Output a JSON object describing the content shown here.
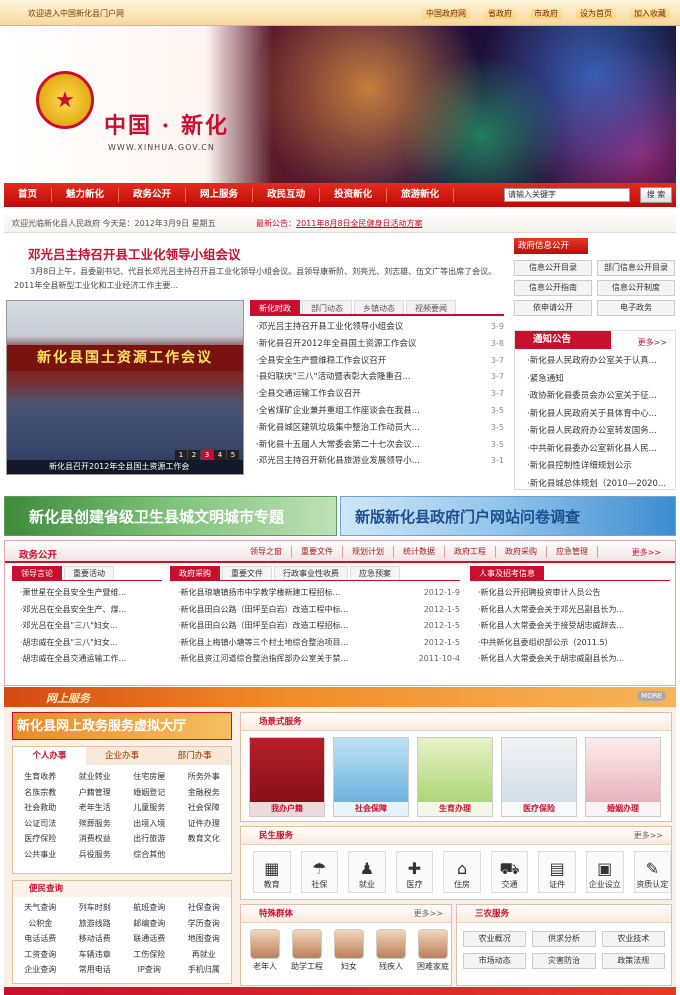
{
  "topbar": {
    "welcome": "欢迎进入中国新化县门户网",
    "links": [
      "中国政府网",
      "省政府",
      "市政府",
      "设为首页",
      "加入收藏"
    ]
  },
  "banner": {
    "title": "中国 · 新化",
    "url": "WWW.XINHUA.GOV.CN"
  },
  "nav": {
    "items": [
      "首页",
      "魅力新化",
      "政务公开",
      "网上服务",
      "政民互动",
      "投资新化",
      "旅游新化"
    ],
    "search_placeholder": "请输入关键字",
    "search_button": "搜 索"
  },
  "infobar": {
    "text": "欢迎光临新化县人民政府 今天是：2012年3月9日 星期五",
    "notice_label": "最新公告：",
    "notice_text": "2011年8月8日全民健身日活动方案"
  },
  "headline": {
    "title": "邓光吕主持召开县工业化领导小组会议",
    "summary": "3月8日上午，县委副书记、代县长邓光吕主持召开县工业化领导小组会议。县领导康新阶、刘亮光、刘志雄、伍文广等出席了会议。 2011年全县新型工业化和工业经济工作主要..."
  },
  "slide": {
    "band": "新化县国土资源工作会议",
    "caption": "新化县召开2012年全县国土资源工作会",
    "dots": [
      "1",
      "2",
      "3",
      "4",
      "5"
    ]
  },
  "news": {
    "tabs": [
      "新化时政",
      "部门动态",
      "乡镇动态",
      "视频要闻"
    ],
    "items": [
      {
        "title": "·邓光吕主持召开县工业化领导小组会议",
        "date": "3-9"
      },
      {
        "title": "·新化县召开2012年全县国土资源工作会议",
        "date": "3-8"
      },
      {
        "title": "·全县安全生产暨维稳工作会议召开",
        "date": "3-7"
      },
      {
        "title": "·县妇联庆\"三八\"活动暨表彰大会隆重召...",
        "date": "3-7"
      },
      {
        "title": "·全县交通运输工作会议召开",
        "date": "3-7"
      },
      {
        "title": "·全省煤矿企业兼并重组工作座谈会在我县...",
        "date": "3-5"
      },
      {
        "title": "·新化县城区建筑垃圾集中整治工作动员大...",
        "date": "3-5"
      },
      {
        "title": "·新化县十五届人大常委会第二十七次会议...",
        "date": "3-5"
      },
      {
        "title": "·邓光吕主持召开新化县旅游业发展领导小...",
        "date": "3-1"
      }
    ]
  },
  "govinfo": {
    "title": "政府信息公开",
    "buttons": [
      "信息公开目录",
      "部门信息公开目录",
      "信息公开指南",
      "信息公开制度",
      "依申请公开",
      "电子政务"
    ]
  },
  "notice": {
    "title": "通知公告",
    "more": "更多>>",
    "items": [
      "·新化县人民政府办公室关于认真...",
      "·紧急通知",
      "·政协新化县委员会办公室关于征...",
      "·新化县人民政府关于县体育中心...",
      "·新化县人民政府办公室转发国务...",
      "·中共新化县委办公室新化县人民...",
      "·新化县控制性详细规划公示",
      "·新化县城总体规划（2010—2020..."
    ]
  },
  "ads": {
    "left": "新化县创建省级卫生县城文明城市专题",
    "right": "新版新化县政府门户网站问卷调查"
  },
  "zw": {
    "title": "政务公开",
    "tabs": [
      "领导之窗",
      "重要文件",
      "规划计划",
      "统计数据",
      "政府工程",
      "政府采购",
      "应急管理"
    ],
    "more": "更多>>"
  },
  "col1": {
    "tabs": [
      "领导言论",
      "重要活动"
    ],
    "items": [
      "·萧世星在全县安全生产暨维...",
      "·邓光吕在全县安全生产、煤...",
      "·邓光吕在全县\"三八\"妇女...",
      "·胡忠威在全县\"三八\"妇女...",
      "·胡忠威在全县交通运输工作..."
    ]
  },
  "col2": {
    "tabs": [
      "政府采购",
      "重要文件",
      "行政事业性收费",
      "应急预案"
    ],
    "items": [
      {
        "title": "·新化县琅塘镇扬市中学教学楼新建工程招标...",
        "date": "2012-1-9"
      },
      {
        "title": "·新化县田白公路（田坪至白岩）改造工程中标...",
        "date": "2012-1-5"
      },
      {
        "title": "·新化县田白公路（田坪至白岩）改造工程招标...",
        "date": "2012-1-5"
      },
      {
        "title": "·新化县上梅镇小塘等三个村土地综合整治项目...",
        "date": "2012-1-5"
      },
      {
        "title": "·新化县资江河道综合整治指挥部办公室关于禁...",
        "date": "2011-10-4"
      }
    ]
  },
  "col3": {
    "tabs": [
      "人事及招考信息"
    ],
    "items": [
      "·新化县公开招聘投资审计人员公告",
      "·新化县人大常委会关于邓光吕副县长为...",
      "·新化县人大常委会关于接受胡忠威辞去...",
      "·中共新化县委组织部公示（2011.5）",
      "·新化县人大常委会关于胡忠威副县长为..."
    ]
  },
  "ws": {
    "title": "网上服务",
    "more": "MORE"
  },
  "hall": {
    "title": "新化县网上政务服务虚拟大厅"
  },
  "sv": {
    "tabs": [
      "个人办事",
      "企业办事",
      "部门办事"
    ],
    "items": [
      "生育收养",
      "就业转业",
      "住宅房屋",
      "所务外事",
      "名族宗教",
      "户籍管理",
      "婚姻登记",
      "金融税务",
      "社会救助",
      "老年生活",
      "儿童服务",
      "社会保障",
      "公证司法",
      "殡葬服务",
      "出境入境",
      "证件办理",
      "医疗保险",
      "消费权益",
      "出行旅游",
      "教育文化",
      "公共事业",
      "兵役服务",
      "综合其他"
    ]
  },
  "bm": {
    "title": "便民查询",
    "items": [
      "天气查询",
      "列车时刻",
      "航班查询",
      "社保查询",
      "公积金",
      "旅游线路",
      "邮编查询",
      "学历查询",
      "电话话费",
      "移动话费",
      "联通话费",
      "地图查询",
      "工资查询",
      "车辆违章",
      "工伤保险",
      "再就业",
      "企业查询",
      "常用电话",
      "IP查询",
      "手机归属"
    ]
  },
  "scene": {
    "title": "场景式服务",
    "items": [
      "我办户籍",
      "社会保障",
      "生育办理",
      "医疗保险",
      "婚姻办理"
    ]
  },
  "life": {
    "title": "民生服务",
    "more": "更多>>",
    "items": [
      {
        "icon": "education-icon",
        "label": "教育"
      },
      {
        "icon": "social-security-icon",
        "label": "社保"
      },
      {
        "icon": "employment-icon",
        "label": "就业"
      },
      {
        "icon": "medical-icon",
        "label": "医疗"
      },
      {
        "icon": "housing-icon",
        "label": "住房"
      },
      {
        "icon": "traffic-icon",
        "label": "交通"
      },
      {
        "icon": "certificate-icon",
        "label": "证件"
      },
      {
        "icon": "enterprise-icon",
        "label": "企业设立"
      },
      {
        "icon": "qualification-icon",
        "label": "资质认定"
      }
    ]
  },
  "group": {
    "title": "特殊群体",
    "more": "更多>>",
    "items": [
      "老年人",
      "助学工程",
      "妇女",
      "残疾人",
      "困难家庭"
    ]
  },
  "three": {
    "title": "三农服务",
    "items": [
      "农业概况",
      "供求分析",
      "农业技术",
      "市场动态",
      "灾害防治",
      "政策法规"
    ]
  }
}
